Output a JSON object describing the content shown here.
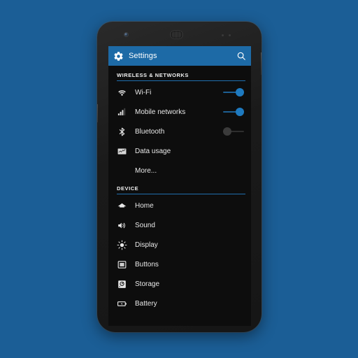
{
  "background": {
    "color": "#1b5e96"
  },
  "device": {
    "name": "android-phone",
    "hardware": {
      "front_camera": "front-camera",
      "earpiece": "earpiece-speaker",
      "proximity_sensor": "proximity-sensor",
      "light_sensor": "light-sensor",
      "power_button": "power-button",
      "volume_button": "volume-button"
    }
  },
  "action_bar": {
    "title": "Settings",
    "icon": "gear-icon",
    "search_icon": "search-icon",
    "background_color": "#1d6aa6",
    "text_color": "#ffffff"
  },
  "accent_color": "#1f6fae",
  "sections": [
    {
      "header": "WIRELESS & NETWORKS",
      "items": [
        {
          "label": "Wi-Fi",
          "icon": "wifi-icon",
          "toggle": "on"
        },
        {
          "label": "Mobile networks",
          "icon": "signal-bars-icon",
          "toggle": "on"
        },
        {
          "label": "Bluetooth",
          "icon": "bluetooth-icon",
          "toggle": "off"
        },
        {
          "label": "Data usage",
          "icon": "data-usage-icon",
          "toggle": "none"
        },
        {
          "label": "More...",
          "icon": "none",
          "toggle": "none"
        }
      ]
    },
    {
      "header": "DEVICE",
      "items": [
        {
          "label": "Home",
          "icon": "home-icon",
          "toggle": "none"
        },
        {
          "label": "Sound",
          "icon": "sound-icon",
          "toggle": "none"
        },
        {
          "label": "Display",
          "icon": "display-brightness-icon",
          "toggle": "none"
        },
        {
          "label": "Buttons",
          "icon": "buttons-fn-icon",
          "toggle": "none"
        },
        {
          "label": "Storage",
          "icon": "storage-disk-icon",
          "toggle": "none"
        },
        {
          "label": "Battery",
          "icon": "battery-icon",
          "toggle": "none"
        }
      ]
    }
  ]
}
